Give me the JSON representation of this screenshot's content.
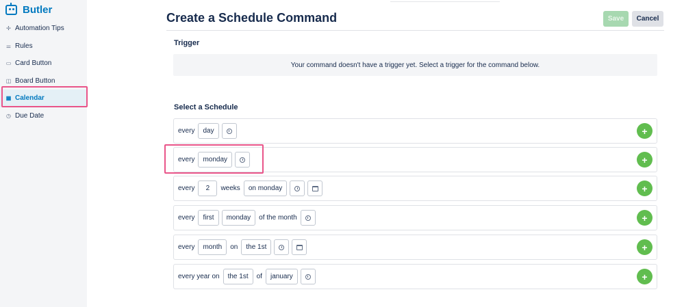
{
  "sidebar": {
    "app_name": "Butler",
    "items": [
      {
        "label": "Automation Tips",
        "icon": "sparkle-icon"
      },
      {
        "label": "Rules",
        "icon": "sliders-icon"
      },
      {
        "label": "Card Button",
        "icon": "card-icon"
      },
      {
        "label": "Board Button",
        "icon": "board-icon"
      },
      {
        "label": "Calendar",
        "icon": "calendar-icon",
        "active": true
      },
      {
        "label": "Due Date",
        "icon": "clock-icon"
      }
    ]
  },
  "header": {
    "title": "Create a Schedule Command",
    "save_label": "Save",
    "cancel_label": "Cancel"
  },
  "trigger": {
    "heading": "Trigger",
    "empty_message": "Your command doesn't have a trigger yet. Select a trigger for the command below."
  },
  "schedule": {
    "heading": "Select a Schedule",
    "rows": [
      {
        "parts": [
          "every",
          "day"
        ]
      },
      {
        "parts": [
          "every",
          "monday"
        ]
      },
      {
        "parts": [
          "every",
          "2",
          "weeks",
          "on monday"
        ]
      },
      {
        "parts": [
          "every",
          "first",
          "monday",
          "of the month"
        ]
      },
      {
        "parts": [
          "every",
          "month",
          "on",
          "the 1st"
        ]
      },
      {
        "parts": [
          "every year on",
          "the 1st",
          "of",
          "january"
        ]
      }
    ],
    "add_label": "+"
  },
  "colors": {
    "accent": "#0079bf",
    "save_disabled": "#a7d8b0",
    "add_green": "#61bd4f",
    "highlight": "#e95489"
  }
}
